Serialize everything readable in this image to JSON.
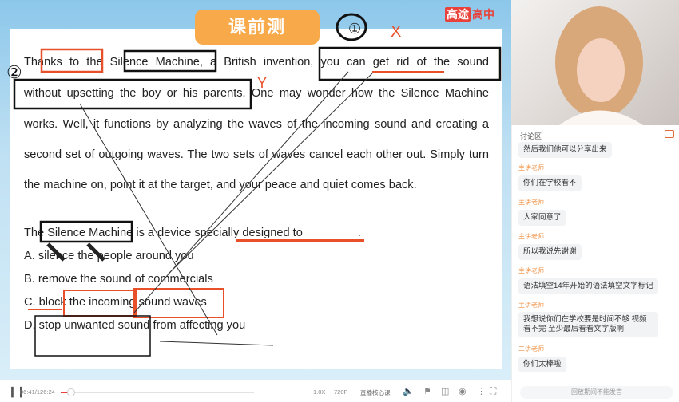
{
  "slide": {
    "badge": "课前测",
    "brand_box": "高途",
    "brand_text": "高中",
    "passage": [
      "Thanks to the Silence Machine, a British invention, you can get rid of the sound",
      "without upsetting the boy or his parents. One may wonder how the Silence Machine",
      "works. Well, it functions by analyzing the waves of the incoming sound and creating a",
      "second set of outgoing waves. The two sets of waves cancel each other out. Simply turn",
      "the machine on, point it at the target, and your peace and quiet comes back."
    ],
    "question": "The Silence Machine is a device specially designed to ________.",
    "options": [
      "A. silence the people around you",
      "B. remove the sound of commercials",
      "C. block the incoming sound waves",
      "D. stop unwanted sound from affecting you"
    ],
    "annotations": {
      "mark1": "①",
      "mark2": "②",
      "x": "X",
      "y": "Y"
    }
  },
  "chat": {
    "title": "讨论区",
    "messages": [
      {
        "who": "",
        "text": "然后我们他可以分享出来"
      },
      {
        "who": "主讲老师",
        "text": "你们在学校看不"
      },
      {
        "who": "主讲老师",
        "text": "人家同意了"
      },
      {
        "who": "主讲老师",
        "text": "所以我说先谢谢"
      },
      {
        "who": "主讲老师",
        "text": "语法填空14年开始的语法填空文字标记"
      },
      {
        "who": "主讲老师",
        "text": "我想说你们在学校要是时间不够 视频看不完 至少最后看看文字版啊"
      },
      {
        "who": "二讲老师",
        "text": "你们太棒啦"
      }
    ],
    "replay_notice": "回放期间不能发言"
  },
  "player": {
    "time": "06:41/126:24",
    "progress": 0.053,
    "speed": "1.0X",
    "quality": "720P",
    "core_lesson": "直播核心课",
    "accent": "#e8423a"
  }
}
